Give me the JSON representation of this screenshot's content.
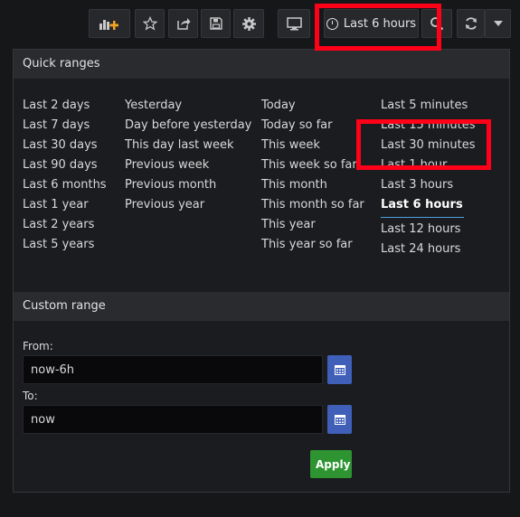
{
  "toolbar": {
    "time_range_label": "Last 6 hours"
  },
  "quick_ranges": {
    "title": "Quick ranges",
    "col1": [
      "Last 2 days",
      "Last 7 days",
      "Last 30 days",
      "Last 90 days",
      "Last 6 months",
      "Last 1 year",
      "Last 2 years",
      "Last 5 years"
    ],
    "col2": [
      "Yesterday",
      "Day before yesterday",
      "This day last week",
      "Previous week",
      "Previous month",
      "Previous year"
    ],
    "col3": [
      "Today",
      "Today so far",
      "This week",
      "This week so far",
      "This month",
      "This month so far",
      "This year",
      "This year so far"
    ],
    "col4": [
      "Last 5 minutes",
      "Last 15 minutes",
      "Last 30 minutes",
      "Last 1 hour",
      "Last 3 hours",
      "Last 6 hours",
      "Last 12 hours",
      "Last 24 hours"
    ],
    "selected": "Last 6 hours"
  },
  "custom_range": {
    "title": "Custom range",
    "from_label": "From:",
    "from_value": "now-6h",
    "to_label": "To:",
    "to_value": "now",
    "apply_label": "Apply"
  },
  "colors": {
    "accent_blue": "#4aa3df",
    "apply_green": "#2d9431",
    "highlight_red": "#ff0018"
  }
}
